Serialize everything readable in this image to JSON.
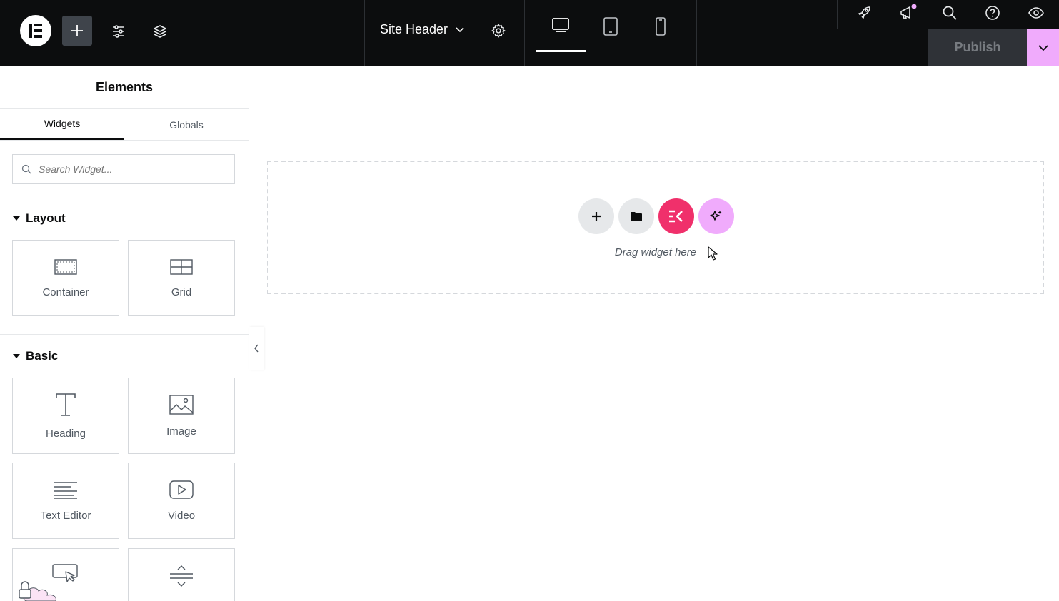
{
  "topbar": {
    "document_title": "Site Header",
    "publish_label": "Publish",
    "colors": {
      "background": "#0c0d0e",
      "publish_accent": "#f0abfc",
      "notification_dot": "#f0abfc"
    }
  },
  "panel": {
    "title": "Elements",
    "tabs": [
      {
        "label": "Widgets"
      },
      {
        "label": "Globals"
      }
    ],
    "search": {
      "placeholder": "Search Widget..."
    },
    "sections": [
      {
        "title": "Layout",
        "widgets": [
          {
            "label": "Container",
            "icon": "container-icon"
          },
          {
            "label": "Grid",
            "icon": "grid-icon"
          }
        ]
      },
      {
        "title": "Basic",
        "widgets": [
          {
            "label": "Heading",
            "icon": "heading-icon"
          },
          {
            "label": "Image",
            "icon": "image-icon"
          },
          {
            "label": "Text Editor",
            "icon": "text-editor-icon"
          },
          {
            "label": "Video",
            "icon": "video-icon"
          },
          {
            "label": "",
            "icon": "button-icon"
          },
          {
            "label": "",
            "icon": "divider-icon"
          }
        ]
      }
    ]
  },
  "canvas": {
    "dropzone_text": "Drag widget here",
    "colors": {
      "kit_button": "#f0306b",
      "ai_button": "#f0abfc",
      "neutral_button": "#e6e8ea"
    }
  }
}
